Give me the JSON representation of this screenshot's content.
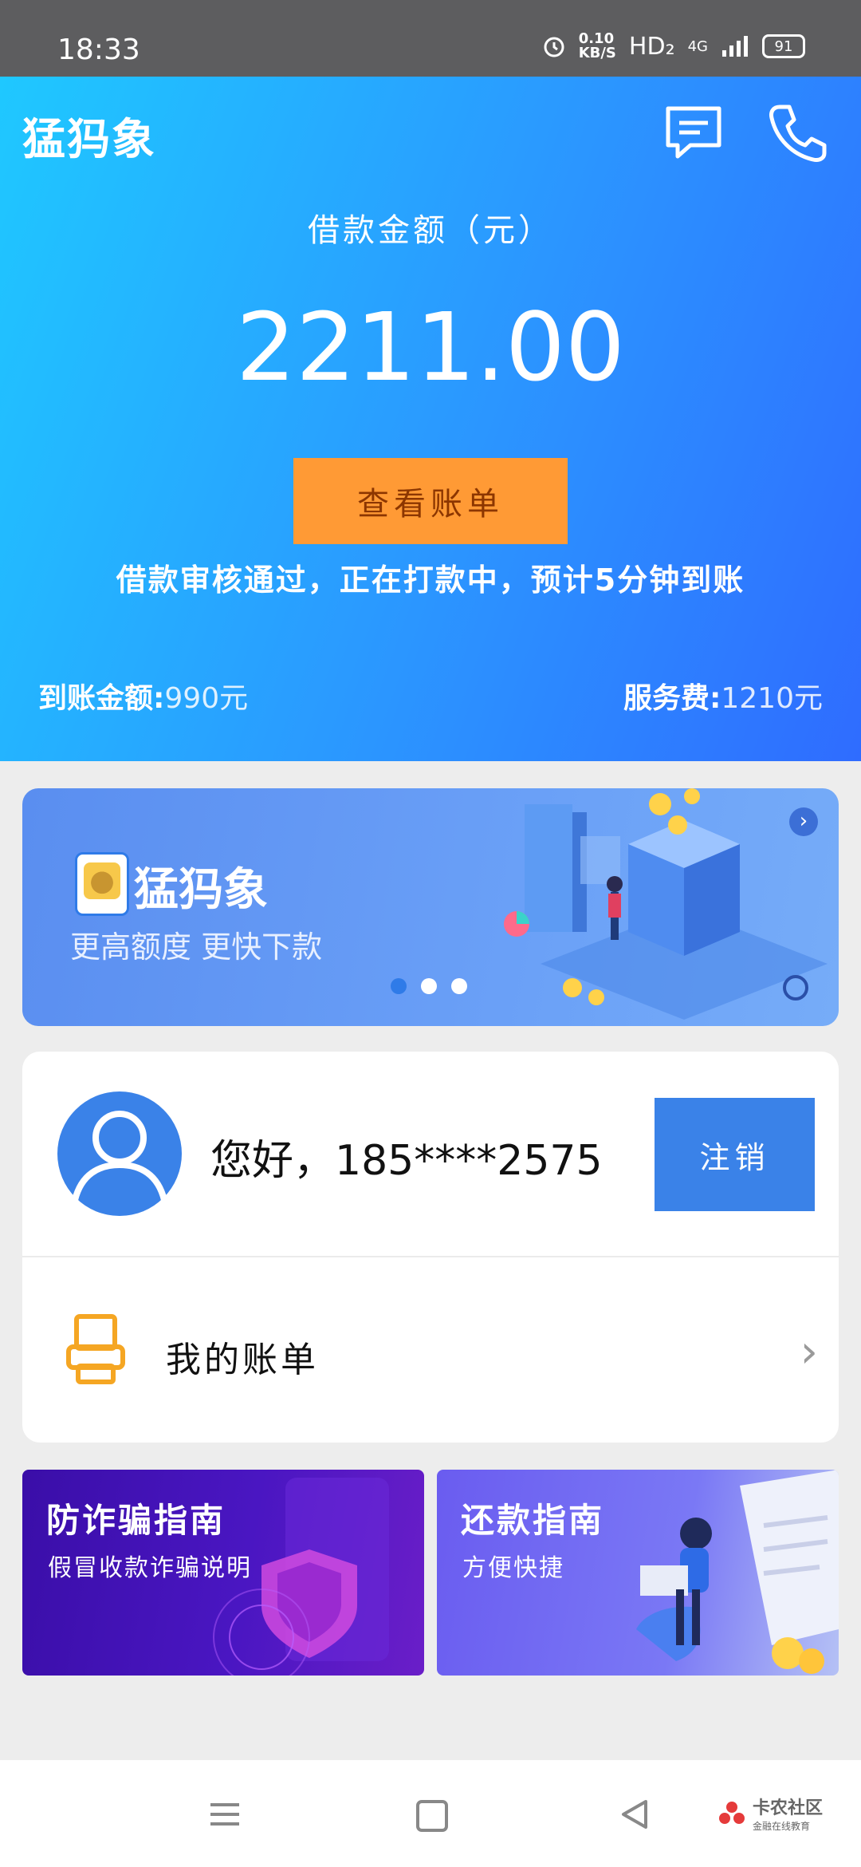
{
  "status_bar": {
    "time": "18:33",
    "speed_value": "0.10",
    "speed_unit": "KB/S",
    "hd": "HD₂",
    "network": "4G",
    "battery": "91"
  },
  "header": {
    "app_name": "猛犸象",
    "message_icon": "message-icon",
    "phone_icon": "phone-icon"
  },
  "loan": {
    "label": "借款金额（元）",
    "amount": "2211.00",
    "view_bill_label": "查看账单",
    "notice": "借款审核通过，正在打款中，预计5分钟到账",
    "arrival_label": "到账金额:",
    "arrival_value": "990元",
    "fee_label": "服务费:",
    "fee_value": "1210元"
  },
  "banner": {
    "title": "猛犸象",
    "subtitle": "更高额度 更快下款",
    "slide_count": 3,
    "active_slide": 1
  },
  "account": {
    "greeting": "您好，185****2575",
    "logout_label": "注销",
    "my_bills_label": "我的账单"
  },
  "tiles": [
    {
      "title": "防诈骗指南",
      "subtitle": "假冒收款诈骗说明"
    },
    {
      "title": "还款指南",
      "subtitle": "方便快捷"
    }
  ],
  "watermark": {
    "title": "卡农社区",
    "subtitle": "金融在线教育"
  },
  "colors": {
    "hero_start": "#1fc8ff",
    "hero_end": "#2f6cff",
    "view_bill_bg": "#ff9a35",
    "logout_bg": "#3a82e8",
    "printer_icon": "#f5a623"
  }
}
